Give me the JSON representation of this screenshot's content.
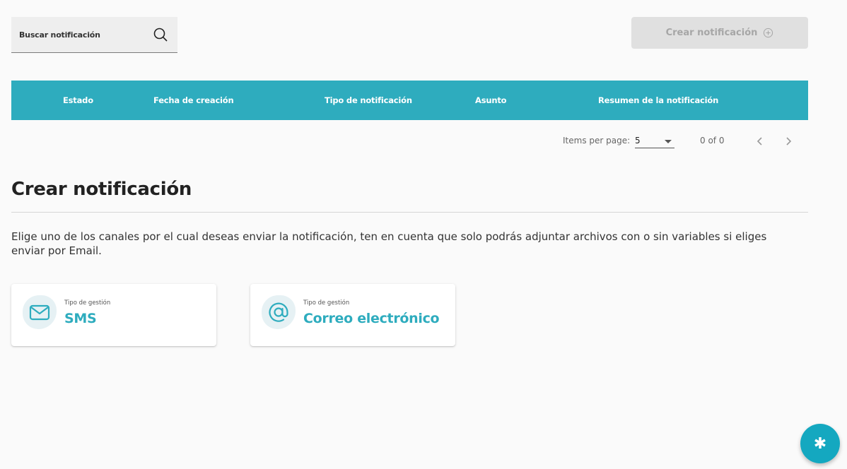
{
  "search": {
    "placeholder": "Buscar notificación",
    "icon": "search-icon"
  },
  "create_button": {
    "label": "Crear notificación",
    "icon": "plus-circle-icon",
    "disabled": true
  },
  "table": {
    "headers": [
      "Estado",
      "Fecha de creación",
      "Tipo de notificación",
      "Asunto",
      "Resumen de la notificación"
    ],
    "header_color": "#2eacbe"
  },
  "paginator": {
    "items_label": "Items per page:",
    "page_size": "5",
    "range": "0 of 0"
  },
  "section": {
    "title": "Crear notificación",
    "description": "Elige uno de los canales por el cual deseas enviar la notificación, ten en cuenta que solo podrás adjuntar archivos con o sin variables si eliges enviar por Email."
  },
  "cards": [
    {
      "kicker": "Tipo de gestión",
      "title": "SMS",
      "icon": "mail-icon"
    },
    {
      "kicker": "Tipo de gestión",
      "title": "Correo electrónico",
      "icon": "at-sign-icon"
    }
  ],
  "fab": {
    "symbol": "✱"
  },
  "colors": {
    "accent": "#2eacbe",
    "fab": "#14a8c0",
    "disabled_bg": "#e0e0e0",
    "disabled_text": "#a6a6a6"
  }
}
